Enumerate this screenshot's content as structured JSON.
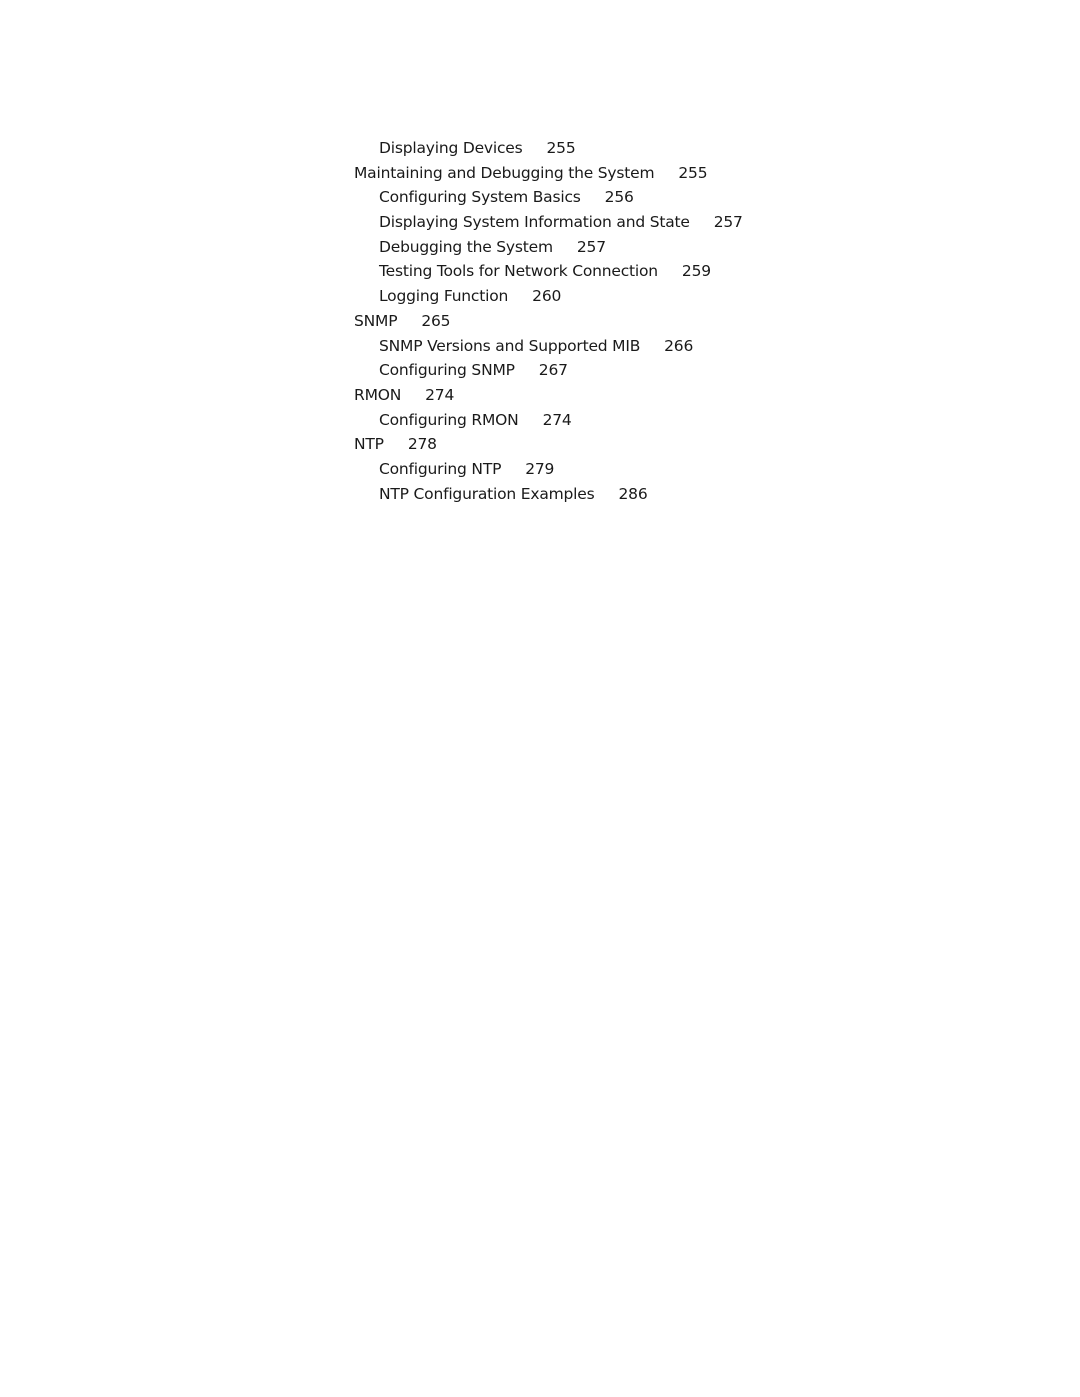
{
  "toc": {
    "entries": [
      {
        "level": 2,
        "title": "Displaying Devices",
        "page": "255"
      },
      {
        "level": 1,
        "title": "Maintaining and Debugging the System",
        "page": "255"
      },
      {
        "level": 2,
        "title": "Configuring System Basics",
        "page": "256"
      },
      {
        "level": 2,
        "title": "Displaying System Information and State",
        "page": "257"
      },
      {
        "level": 2,
        "title": "Debugging the System",
        "page": "257"
      },
      {
        "level": 2,
        "title": "Testing Tools for Network Connection",
        "page": "259"
      },
      {
        "level": 2,
        "title": "Logging Function",
        "page": "260"
      },
      {
        "level": 1,
        "title": "SNMP",
        "page": "265"
      },
      {
        "level": 2,
        "title": "SNMP Versions and Supported MIB",
        "page": "266"
      },
      {
        "level": 2,
        "title": "Configuring SNMP",
        "page": "267"
      },
      {
        "level": 1,
        "title": "RMON",
        "page": "274"
      },
      {
        "level": 2,
        "title": "Configuring RMON",
        "page": "274"
      },
      {
        "level": 1,
        "title": "NTP",
        "page": "278"
      },
      {
        "level": 2,
        "title": "Configuring NTP",
        "page": "279"
      },
      {
        "level": 2,
        "title": "NTP Configuration Examples",
        "page": "286"
      }
    ]
  }
}
